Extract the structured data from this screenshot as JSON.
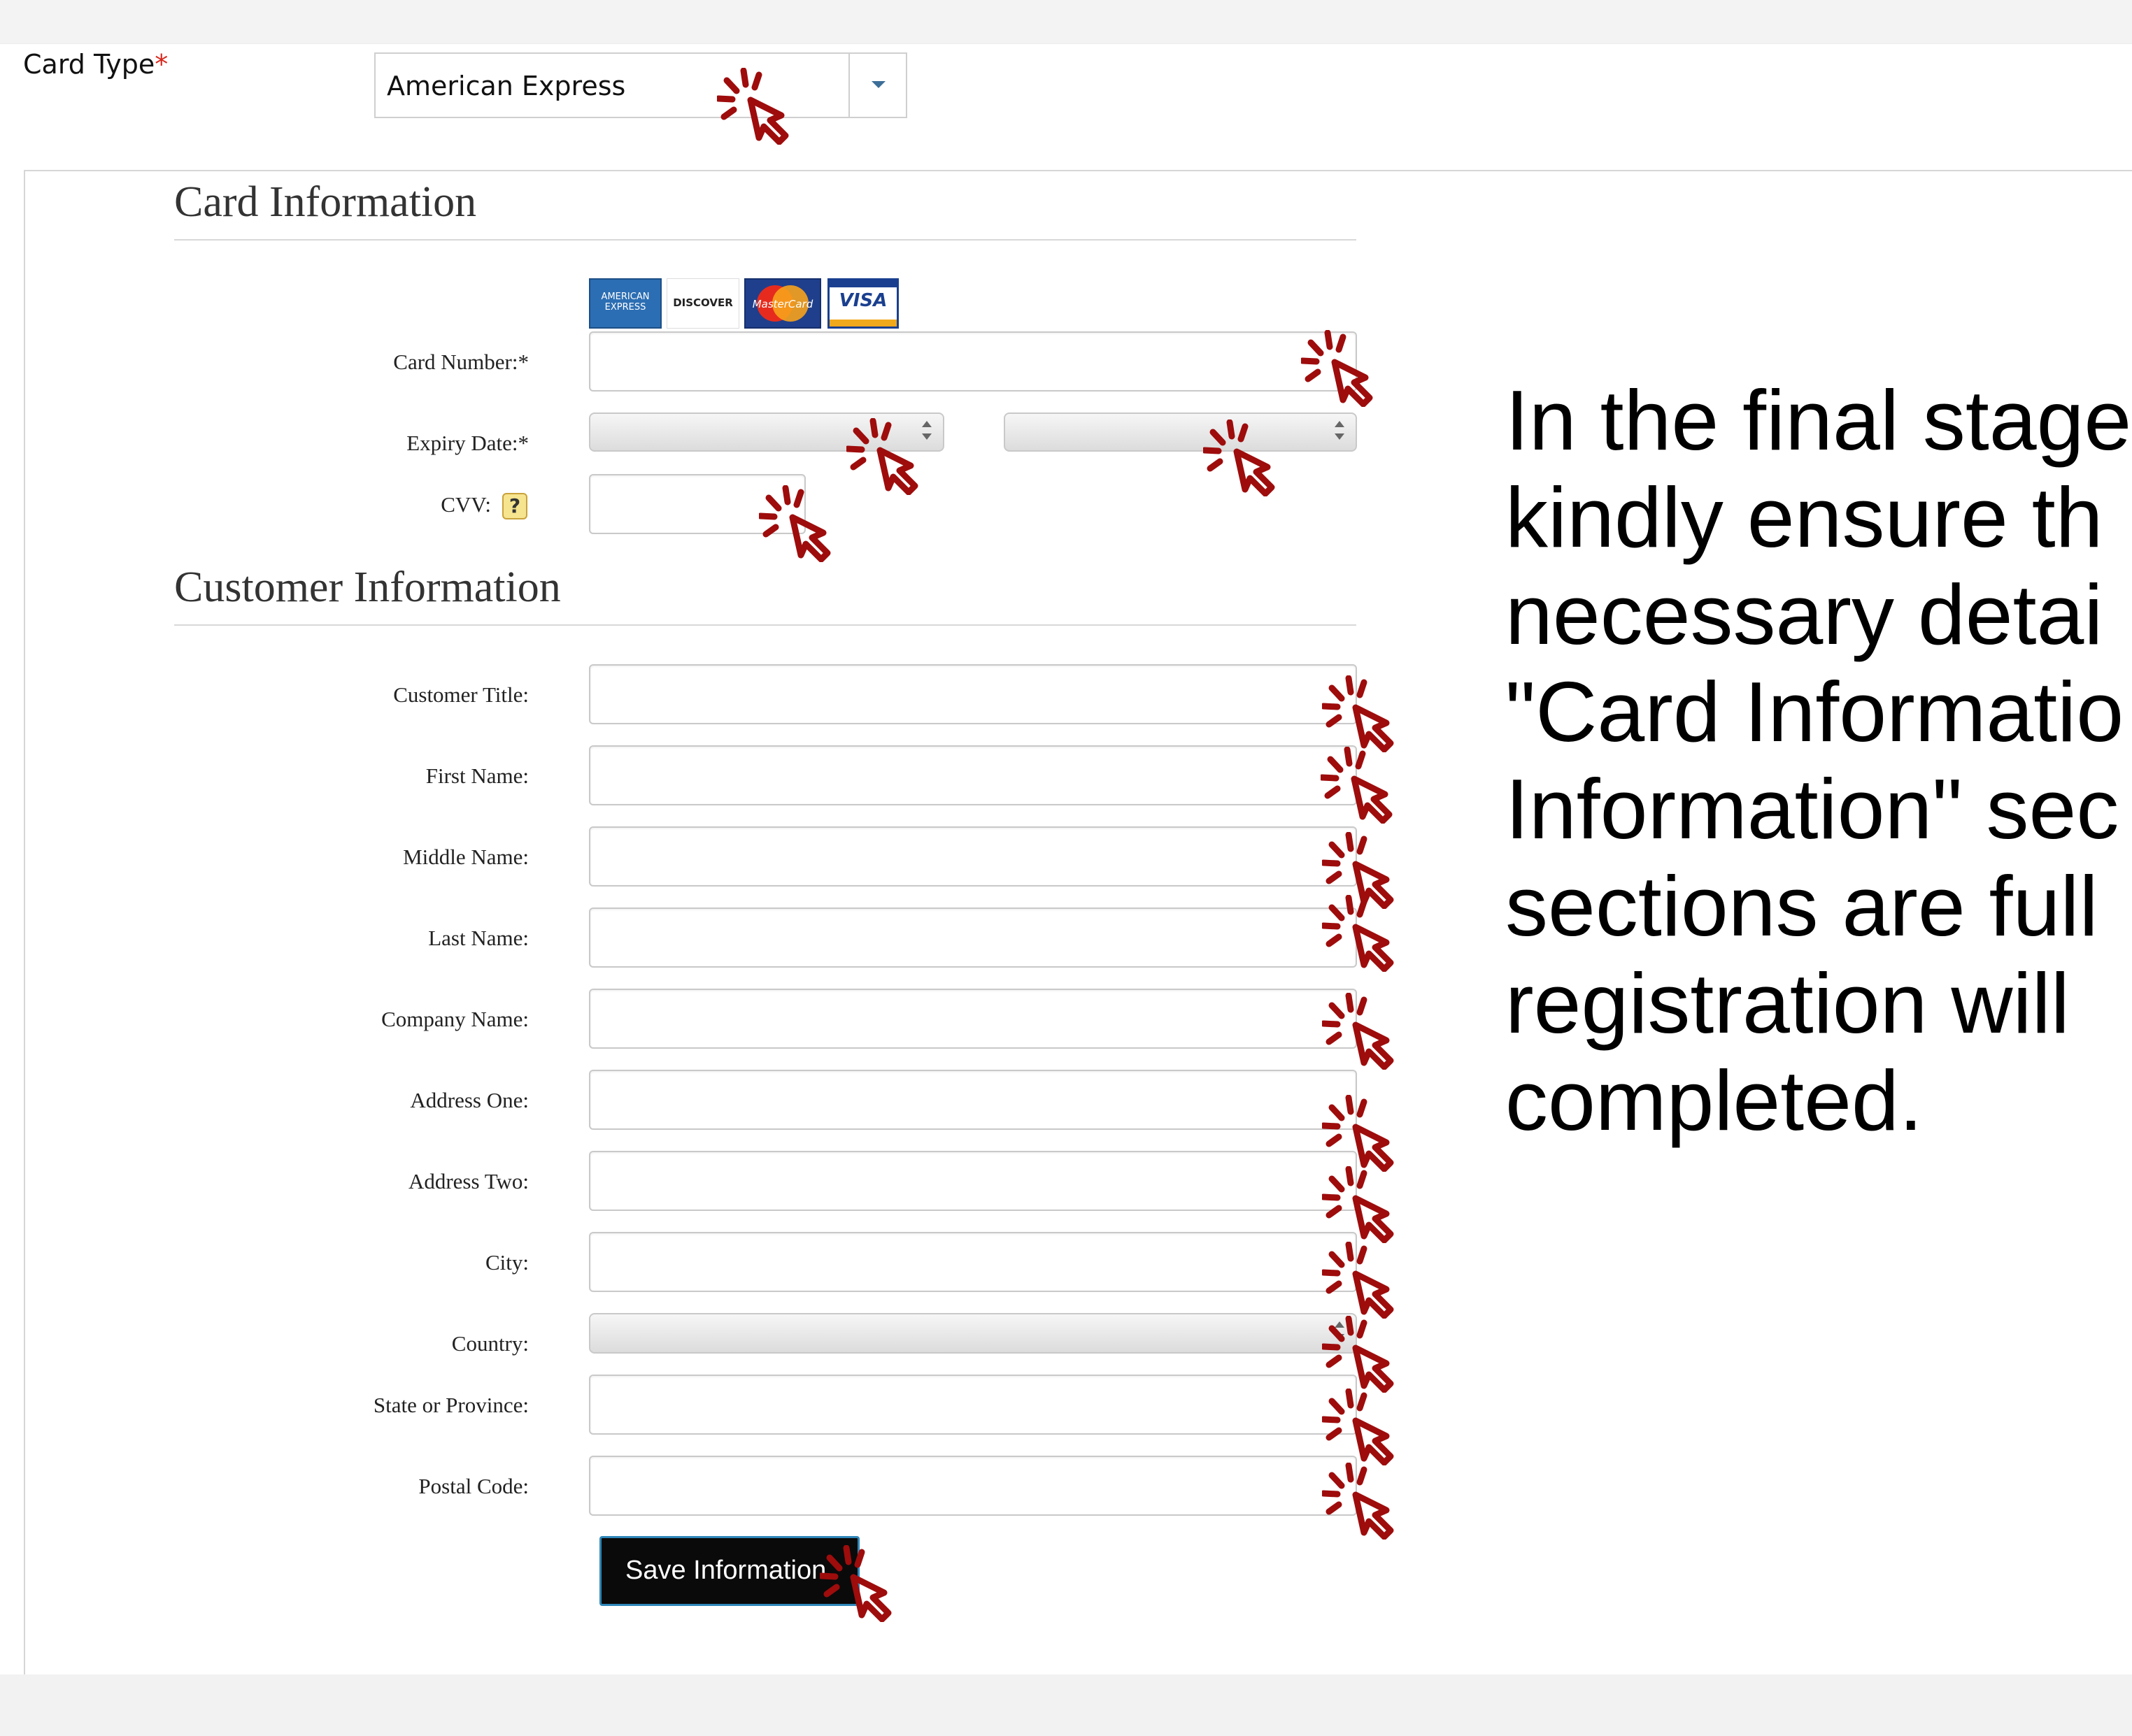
{
  "card_type": {
    "label": "Card Type",
    "required_mark": "*",
    "selected": "American Express"
  },
  "card_info": {
    "title": "Card Information",
    "logos": [
      "AMERICAN EXPRESS",
      "DISCOVER",
      "MasterCard",
      "VISA"
    ],
    "card_number_label": "Card Number:*",
    "expiry_label": "Expiry Date:*",
    "cvv_label": "CVV:",
    "cvv_help": "?"
  },
  "customer_info": {
    "title": "Customer Information",
    "fields": [
      "Customer Title:",
      "First Name:",
      "Middle Name:",
      "Last Name:",
      "Company Name:",
      "Address One:",
      "Address Two:",
      "City:",
      "Country:",
      "State or Province:",
      "Postal Code:"
    ]
  },
  "save_button": "Save Information",
  "instruction_lines": [
    "In the final stage",
    "kindly ensure th",
    "necessary detai",
    "\"Card Informatio",
    "Information\" sec",
    "sections are full",
    "registration will",
    "completed."
  ],
  "colors": {
    "cursor": "#9e0c0c",
    "button_border": "#2f87b8",
    "required": "#d9261c"
  },
  "icons": {
    "cursor": "click-cursor-icon",
    "help": "help-icon",
    "dropdown": "chevron-down-icon"
  }
}
